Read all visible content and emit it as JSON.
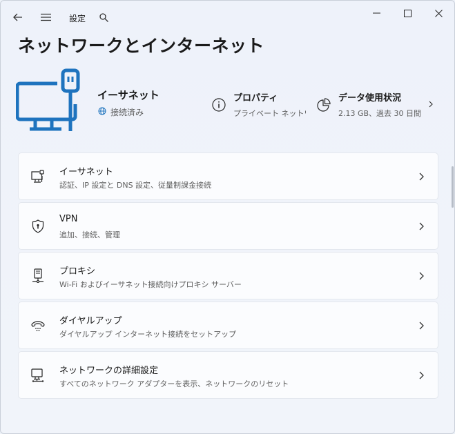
{
  "titlebar": {
    "app_title": "設定",
    "back_icon": "back-arrow-icon",
    "menu_icon": "hamburger-menu-icon",
    "search_icon": "search-icon"
  },
  "page": {
    "title": "ネットワークとインターネット"
  },
  "connection": {
    "name": "イーサネット",
    "status": "接続済み",
    "status_icon": "globe-icon",
    "hero_icon": "wired-monitor-icon"
  },
  "properties": {
    "title": "プロパティ",
    "subtitle": "プライベート ネットワーク",
    "icon": "info-icon"
  },
  "data_usage": {
    "title": "データ使用状況",
    "subtitle": "2.13 GB、過去 30 日間",
    "icon": "pie-chart-icon"
  },
  "settings_items": [
    {
      "title": "イーサネット",
      "subtitle": "認証、IP 設定と DNS 設定、従量制課金接続",
      "icon": "ethernet-monitor-icon"
    },
    {
      "title": "VPN",
      "subtitle": "追加、接続、管理",
      "icon": "shield-icon"
    },
    {
      "title": "プロキシ",
      "subtitle": "Wi-Fi およびイーサネット接続向けプロキシ サーバー",
      "icon": "proxy-icon"
    },
    {
      "title": "ダイヤルアップ",
      "subtitle": "ダイヤルアップ インターネット接続をセットアップ",
      "icon": "dialup-phone-icon"
    },
    {
      "title": "ネットワークの詳細設定",
      "subtitle": "すべてのネットワーク アダプターを表示、ネットワークのリセット",
      "icon": "network-adapter-icon"
    }
  ],
  "colors": {
    "accent": "#1e73be",
    "background": "#eef2f9",
    "card": "#fbfcfe"
  }
}
